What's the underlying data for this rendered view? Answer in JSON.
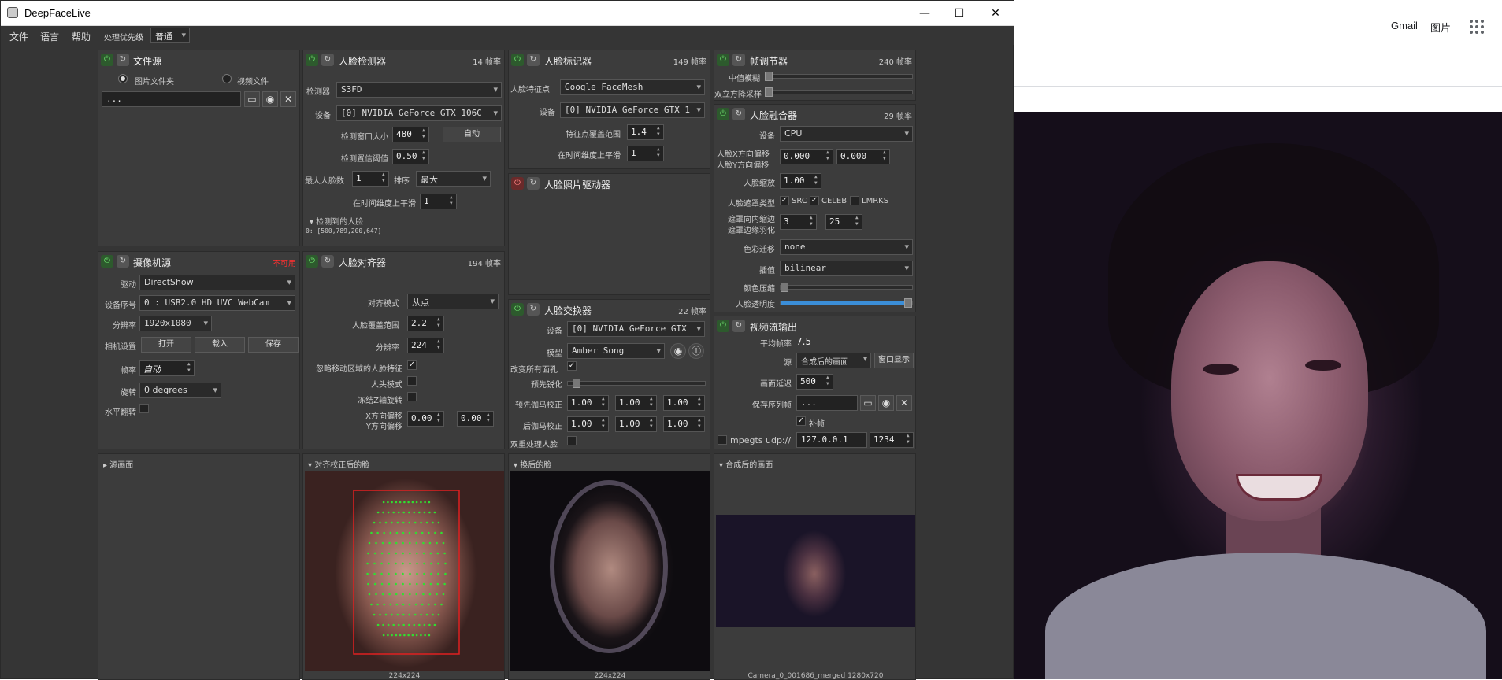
{
  "browser": {
    "gmail": "Gmail",
    "images": "图片",
    "apps_icon": "apps-grid-icon"
  },
  "window": {
    "title": "DeepFaceLive",
    "min": "—",
    "max": "☐",
    "close": "✕"
  },
  "menu": {
    "file": "文件",
    "language": "语言",
    "help": "帮助",
    "priority_label": "处理优先级",
    "priority_value": "普通"
  },
  "file_source": {
    "title": "文件源",
    "opt_image_folder": "图片文件夹",
    "opt_video_file": "视频文件",
    "path": "..."
  },
  "camera_source": {
    "title": "摄像机源",
    "status": "不可用",
    "driver_label": "驱动",
    "driver": "DirectShow",
    "device_label": "设备序号",
    "device": "0 : USB2.0 HD UVC WebCam",
    "resolution_label": "分辨率",
    "resolution": "1920x1080",
    "settings_label": "相机设置",
    "open": "打开",
    "load": "载入",
    "save": "保存",
    "fps_label": "帧率",
    "fps": "自动",
    "rotation_label": "旋转",
    "rotation": "0 degrees",
    "hflip_label": "水平翻转"
  },
  "face_detector": {
    "title": "人脸检测器",
    "fps": "14 帧率",
    "detector_label": "检测器",
    "detector": "S3FD",
    "device_label": "设备",
    "device": "[0] NVIDIA GeForce GTX 106C",
    "window_label": "检测窗口大小",
    "window": "480",
    "auto": "自动",
    "threshold_label": "检测置信阈值",
    "threshold": "0.50",
    "max_faces_label": "最大人脸数",
    "max_faces": "1",
    "sort_label": "排序",
    "sort": "最大",
    "temporal_label": "在时间维度上平滑",
    "temporal": "1",
    "detected_label": "检测到的人脸",
    "detected": "0: [500,789,200,647]"
  },
  "face_marker": {
    "title": "人脸标记器",
    "fps": "149 帧率",
    "marker_label": "人脸特征点",
    "marker": "Google FaceMesh",
    "device_label": "设备",
    "device": "[0] NVIDIA GeForce GTX 1",
    "coverage_label": "特征点覆盖范围",
    "coverage": "1.4",
    "temporal_label": "在时间维度上平滑",
    "temporal": "1"
  },
  "face_animator": {
    "title": "人脸照片驱动器"
  },
  "face_aligner": {
    "title": "人脸对齐器",
    "fps": "194 帧率",
    "mode_label": "对齐模式",
    "mode": "从点",
    "coverage_label": "人脸覆盖范围",
    "coverage": "2.2",
    "resolution_label": "分辨率",
    "resolution": "224",
    "exclude_label": "忽略移动区域的人脸特征",
    "head_mode_label": "人头模式",
    "freeze_label": "冻结Z轴旋转",
    "xoff_label": "X方向偏移",
    "yoff_label": "Y方向偏移",
    "xoff": "0.00",
    "yoff": "0.00"
  },
  "face_swapper": {
    "title": "人脸交换器",
    "fps": "22 帧率",
    "device_label": "设备",
    "device": "[0] NVIDIA GeForce GTX",
    "model_label": "模型",
    "model": "Amber Song",
    "swap_all_label": "改变所有面孔",
    "presharpen_label": "预先锐化",
    "pre_gamma_label": "预先伽马校正",
    "post_gamma_label": "后伽马校正",
    "g1": "1.00",
    "g2": "1.00",
    "g3": "1.00",
    "dual_label": "双重处理人脸"
  },
  "frame_adjuster": {
    "title": "帧调节器",
    "fps": "240 帧率",
    "median_label": "中值模糊",
    "bilateral_label": "双立方降采样"
  },
  "face_merger": {
    "title": "人脸融合器",
    "fps": "29 帧率",
    "device_label": "设备",
    "device": "CPU",
    "xoff_label": "人脸X方向偏移",
    "yoff_label": "人脸Y方向偏移",
    "xoff": "0.000",
    "yoff": "0.000",
    "scale_label": "人脸缩放",
    "scale": "1.00",
    "mask_type_label": "人脸遮罩类型",
    "mask_src": "SRC",
    "mask_celeb": "CELEB",
    "mask_lmrks": "LMRKS",
    "erode_label": "遮罩向内缩边",
    "blur_label": "遮罩边缘羽化",
    "erode": "3",
    "blur": "25",
    "color_transfer_label": "色彩迁移",
    "color_transfer": "none",
    "interp_label": "插值",
    "interp": "bilinear",
    "color_compress_label": "颜色压缩",
    "opacity_label": "人脸透明度"
  },
  "stream_output": {
    "title": "视频流输出",
    "avg_fps_label": "平均帧率",
    "avg_fps": "7.5",
    "source_label": "源",
    "source": "合成后的画面",
    "window_btn": "窗口显示",
    "delay_label": "画面延迟",
    "delay": "500",
    "save_label": "保存序列帧",
    "save_path": "...",
    "fill_label": "补帧",
    "mpegts_label": "mpegts udp://",
    "ip": "127.0.0.1",
    "port": "1234"
  },
  "previews": {
    "source": "源画面",
    "aligned": "对齐校正后的脸",
    "swapped": "换后的脸",
    "merged": "合成后的画面",
    "aligned_cap": "224x224",
    "swapped_cap": "224x224",
    "merged_cap": "Camera_0_001686_merged 1280x720"
  }
}
